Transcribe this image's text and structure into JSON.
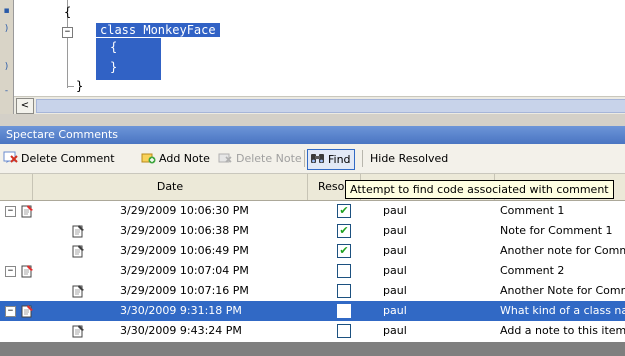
{
  "editor": {
    "lines": [
      "{",
      "class MonkeyFace",
      "{",
      "}",
      "}"
    ],
    "fold_symbol": "−"
  },
  "scrollbar": {
    "left_arrow": "<"
  },
  "panel": {
    "title": "Spectare Comments",
    "toolbar": {
      "delete_comment": "Delete Comment",
      "add_note": "Add Note",
      "delete_note": "Delete Note",
      "find": "Find",
      "hide_resolved": "Hide Resolved"
    },
    "tooltip": "Attempt to find code associated with comment",
    "columns": {
      "date": "Date",
      "resolved": "Resol",
      "user": "",
      "comment": ""
    },
    "rows": [
      {
        "type": "comment",
        "expander": "−",
        "date": "3/29/2009 10:06:30 PM",
        "resolved": true,
        "user": "paul",
        "text": "Comment 1",
        "selected": false
      },
      {
        "type": "note",
        "expander": "",
        "date": "3/29/2009 10:06:38 PM",
        "resolved": true,
        "user": "paul",
        "text": "Note for Comment 1",
        "selected": false
      },
      {
        "type": "note",
        "expander": "",
        "date": "3/29/2009 10:06:49 PM",
        "resolved": true,
        "user": "paul",
        "text": "Another note for Comm",
        "selected": false
      },
      {
        "type": "comment",
        "expander": "−",
        "date": "3/29/2009 10:07:04 PM",
        "resolved": false,
        "user": "paul",
        "text": "Comment 2",
        "selected": false
      },
      {
        "type": "note",
        "expander": "",
        "date": "3/29/2009 10:07:16 PM",
        "resolved": false,
        "user": "paul",
        "text": "Another Note for Comm",
        "selected": false
      },
      {
        "type": "comment",
        "expander": "−",
        "date": "3/30/2009 9:31:18 PM",
        "resolved": false,
        "user": "paul",
        "text": "What kind of a class na",
        "selected": true
      },
      {
        "type": "note",
        "expander": "",
        "date": "3/30/2009 9:43:24 PM",
        "resolved": false,
        "user": "paul",
        "text": "Add a note to this item",
        "selected": false
      }
    ],
    "check_mark": "✔"
  },
  "colors": {
    "selection": "#3169c5",
    "panel_title": "#4a75c2",
    "check_green": "#21a121",
    "tooltip_bg": "#ffffe1"
  }
}
